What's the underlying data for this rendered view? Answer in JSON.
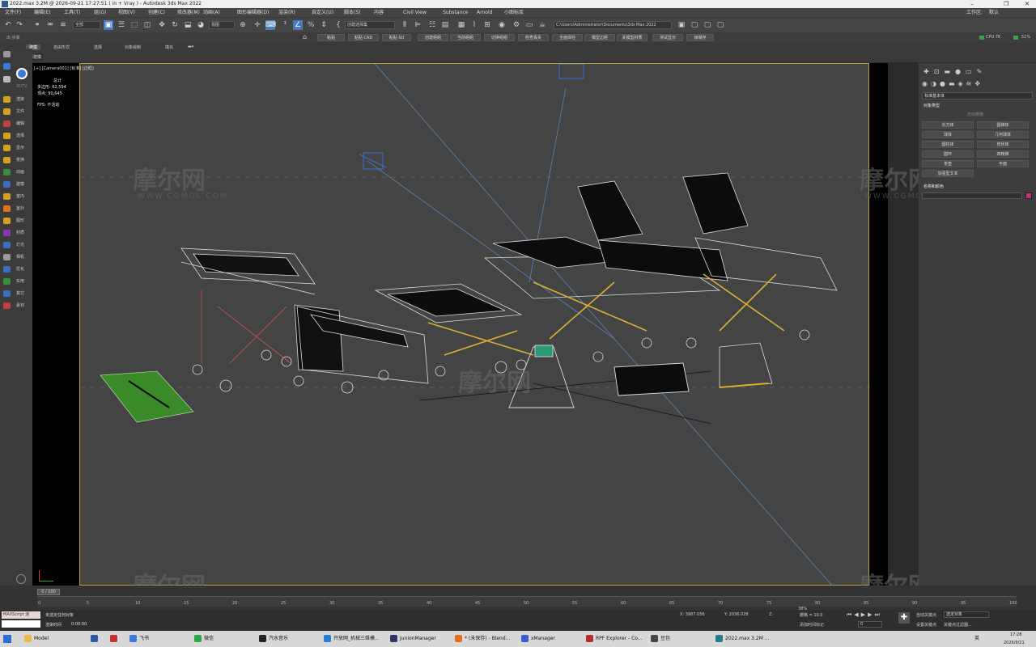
{
  "window": {
    "title": "2022.max  3.2M @ 2026-09-21 17:27:51  ( in + Vray ) - Autodesk 3ds Max 2022"
  },
  "menu": [
    "文件(F)",
    "编辑(E)",
    "工具(T)",
    "组(G)",
    "视图(V)",
    "创建(C)",
    "修改器(M)",
    "动画(A)",
    "图形编辑器(D)",
    "渲染(R)",
    "自定义(U)",
    "脚本(S)",
    "内容",
    "Civil View",
    "Substance",
    "Arnold",
    "小图标库"
  ],
  "menu_right": {
    "workspace_label": "工作区:",
    "workspace_value": "默认"
  },
  "toolbar": {
    "filter": "全部",
    "coord": "视图",
    "selset": "创建选择集",
    "path": "C:\\Users\\Administrator\\Documents\\3ds Max 2022"
  },
  "row2": {
    "small": "出 步骤",
    "buttons": [
      "粘贴",
      "粘贴 CAD",
      "粘贴 SU",
      "创建组组",
      "当前组组",
      "切换组组",
      "检查丢失",
      "全面体检",
      "模型边经",
      "关模型材质",
      "测试显示",
      "帧缓存"
    ],
    "cpu": "CPU 7K",
    "mem": "51%"
  },
  "ribbon": {
    "tabs": [
      "建模",
      "自由形式",
      "选择",
      "对象绘制",
      "填充"
    ],
    "sub": "多边形建模"
  },
  "leftstrip": {
    "top_label": "3DTV",
    "items": [
      {
        "label": "渲染",
        "color": "#d4a020"
      },
      {
        "label": "文件",
        "color": "#d4a020"
      },
      {
        "label": "编辑",
        "color": "#c04040"
      },
      {
        "label": "选择",
        "color": "#d4a020"
      },
      {
        "label": "显示",
        "color": "#d4a020"
      },
      {
        "label": "变换",
        "color": "#d4a020"
      },
      {
        "label": "动画",
        "color": "#3a8f3a"
      },
      {
        "label": "建模",
        "color": "#3a6fbf"
      },
      {
        "label": "室内",
        "color": "#d4a020"
      },
      {
        "label": "室外",
        "color": "#e07020"
      },
      {
        "label": "图形",
        "color": "#d4a020"
      },
      {
        "label": "材质",
        "color": "#8a3ab0"
      },
      {
        "label": "灯光",
        "color": "#3a6fbf"
      },
      {
        "label": "相机",
        "color": "#999999"
      },
      {
        "label": "优化",
        "color": "#3a6fbf"
      },
      {
        "label": "实用",
        "color": "#3a8f3a"
      },
      {
        "label": "其它",
        "color": "#3a6fbf"
      },
      {
        "label": "素材",
        "color": "#c04040"
      }
    ]
  },
  "viewport": {
    "label": "[+] [Camera001] [标准] [边框]",
    "stats_title": "总计",
    "polys_label": "多边形:",
    "polys_value": "62,594",
    "verts_label": "顶点:",
    "verts_value": "90,645",
    "fps_label": "FPS:",
    "fps_value": "不活动"
  },
  "watermark": {
    "text": "摩尔网",
    "sub": "WWW.CGMOL.COM"
  },
  "rpanel": {
    "dropdown": "标准基本体",
    "rollout1": "对象类型",
    "autogrid": "自动栅格",
    "buttons": [
      "长方体",
      "圆锥体",
      "球体",
      "几何球体",
      "圆柱体",
      "管状体",
      "圆环",
      "四棱锥",
      "茶壶",
      "平面",
      "加强型文本"
    ],
    "rollout2": "名称和颜色",
    "color": "#c0347a"
  },
  "timeline": {
    "frame": "0 / 100",
    "ticks": [
      "0",
      "5",
      "10",
      "15",
      "20",
      "25",
      "30",
      "35",
      "40",
      "45",
      "50",
      "55",
      "60",
      "65",
      "70",
      "75",
      "80",
      "85",
      "90",
      "95",
      "100"
    ]
  },
  "status": {
    "maxscript": "MAXScript 迷",
    "line1": "未选定任何对象",
    "line2_label": "渲染时间",
    "line2_value": "0:00:00",
    "x": "X: 3987.056",
    "y": "Y: 2036.028",
    "z": "Z:",
    "grid": "栅格 = 10.0",
    "addtime": "添加时间标记",
    "autokey": "自动关键点",
    "setkey": "设置关键点",
    "selobj": "选定对象",
    "keyfilter": "关键点过滤器...",
    "frame_num": "0",
    "mem_pct": "38%",
    "mem_lbl": "内存占用"
  },
  "taskbar": {
    "items": [
      {
        "label": "Model",
        "color": "#e8b94a"
      },
      {
        "label": "",
        "color": "#2a5c9e"
      },
      {
        "label": "",
        "color": "#c03030"
      },
      {
        "label": "飞书",
        "color": "#3a7bd5"
      },
      {
        "label": "微信",
        "color": "#2aa845"
      },
      {
        "label": "汽水音乐",
        "color": "#222222"
      },
      {
        "label": "开放网_机械三维模...",
        "color": "#2a7bd5"
      },
      {
        "label": "JunionManager",
        "color": "#333366"
      },
      {
        "label": "* (未保存) - Blend...",
        "color": "#e07020"
      },
      {
        "label": "xManager",
        "color": "#3a5fcd"
      },
      {
        "label": "RPF Explorer - Co...",
        "color": "#b03030"
      },
      {
        "label": "豆包",
        "color": "#444444"
      },
      {
        "label": "2022.max  3.2M ...",
        "color": "#2a7a8a"
      }
    ],
    "time": "17:28",
    "date": "2026/9/21",
    "ime": "英"
  }
}
